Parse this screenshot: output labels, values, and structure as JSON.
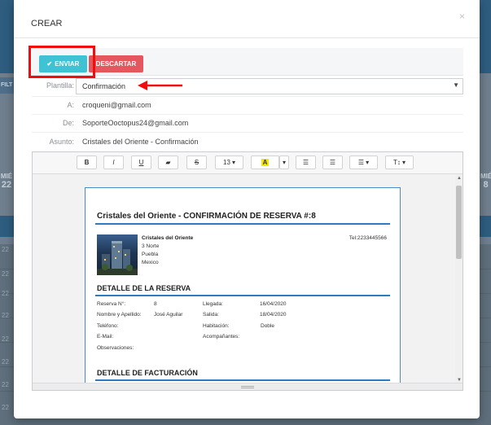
{
  "modal": {
    "title": "CREAR",
    "close": "×"
  },
  "actions": {
    "send_label": "ENVIAR",
    "discard_label": "DESCARTAR"
  },
  "form": {
    "template_label": "Plantilla:",
    "template_value": "Confirmación",
    "to_label": "A:",
    "to_value": "croqueni@gmail.com",
    "from_label": "De:",
    "from_value": "SoporteOoctopus24@gmail.com",
    "subject_label": "Asunto:",
    "subject_value": "Cristales del Oriente - Confirmación"
  },
  "editor_toolbar": {
    "bold": "B",
    "italic": "I",
    "underline": "U",
    "eraser": "▰",
    "strike": "S",
    "font_size": "13",
    "color": "A",
    "bullet_list": "☰",
    "ordered_list": "☰",
    "align": "☰",
    "text_style": "T↕"
  },
  "document": {
    "title": "Cristales del Oriente - CONFIRMACIÓN DE RESERVA #:8",
    "hotel_name": "Cristales del Oriente",
    "address_1": "3 Norte",
    "address_2": "Puebla",
    "address_3": "Mexico",
    "phone": "Tel:2233445566",
    "section_reservation": "DETALLE DE LA RESERVA",
    "reservation_no_label": "Reserva N°:",
    "reservation_no_value": "8",
    "arrival_label": "Llegada:",
    "arrival_value": "16/04/2020",
    "name_label": "Nombre y Apellido:",
    "name_value": "José Aguilar",
    "departure_label": "Salida:",
    "departure_value": "18/04/2020",
    "phone_label": "Teléfono:",
    "room_label": "Habitación:",
    "room_value": "Doble",
    "email_label": "E-Mail:",
    "companions_label": "Acompañantes:",
    "notes_label": "Observaciones:",
    "section_billing": "DETALLE DE FACTURACIÓN"
  },
  "background": {
    "left_tab": "FILT",
    "day_right": "MIÉ",
    "day_right_num": "8",
    "day_left": "MIÉ",
    "day_left_num": "22",
    "row_nums": [
      "22",
      "22",
      "22",
      "22",
      "22",
      "22",
      "22",
      "22"
    ]
  },
  "colors": {
    "send": "#3fc3d4",
    "discard": "#e4575f",
    "highlight": "#f20c0c",
    "doc_rule": "#2e7bbf"
  }
}
